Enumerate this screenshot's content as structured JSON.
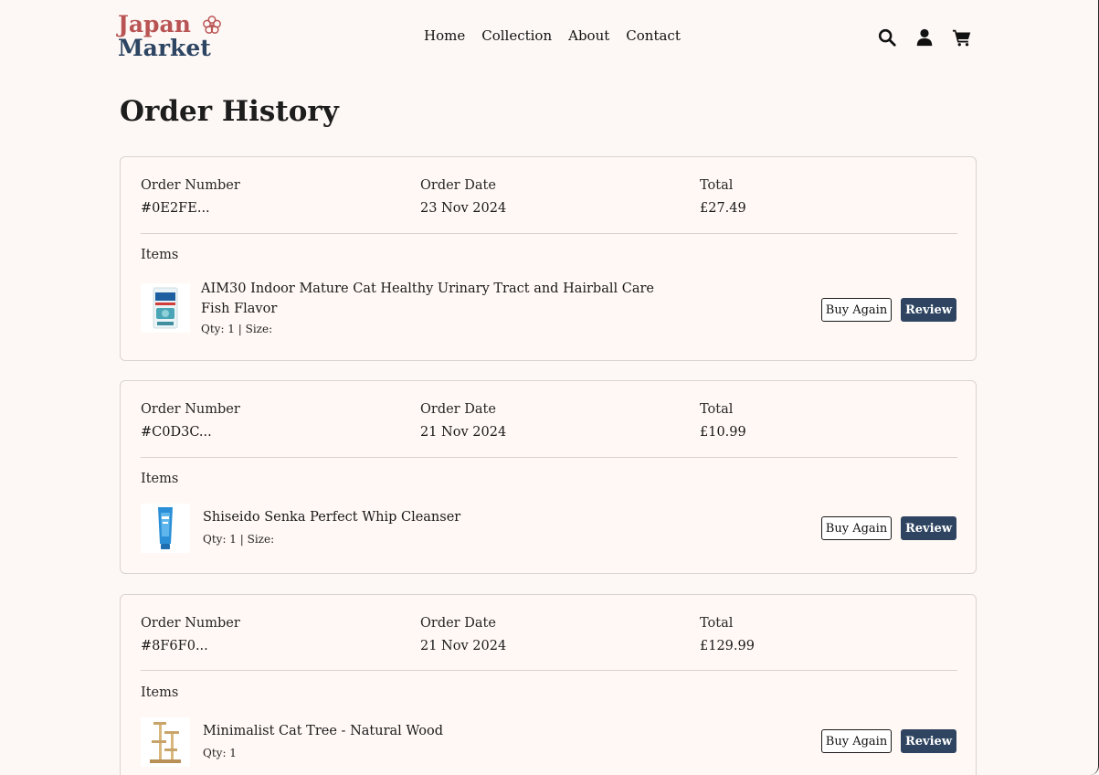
{
  "brand": {
    "line1": "Japan",
    "line2": "Market",
    "color_primary": "#b95454",
    "color_secondary": "#2d4563",
    "flower_icon": "sakura-icon"
  },
  "nav": {
    "items": [
      "Home",
      "Collection",
      "About",
      "Contact"
    ]
  },
  "header_icons": [
    "search-icon",
    "user-icon",
    "cart-icon"
  ],
  "page": {
    "title": "Order History"
  },
  "labels": {
    "order_number": "Order Number",
    "order_date": "Order Date",
    "total": "Total",
    "items": "Items",
    "buy_again": "Buy Again",
    "review": "Review"
  },
  "orders": [
    {
      "number": "#0E2FE...",
      "date": "23 Nov 2024",
      "total": "£27.49",
      "item": {
        "name": "AIM30 Indoor Mature Cat Healthy Urinary Tract and Hairball Care Fish Flavor",
        "details": "Qty: 1 | Size:"
      }
    },
    {
      "number": "#C0D3C...",
      "date": "21 Nov 2024",
      "total": "£10.99",
      "item": {
        "name": "Shiseido Senka Perfect Whip Cleanser",
        "details": "Qty: 1 | Size:"
      }
    },
    {
      "number": "#8F6F0...",
      "date": "21 Nov 2024",
      "total": "£129.99",
      "item": {
        "name": "Minimalist Cat Tree - Natural Wood",
        "details": "Qty: 1"
      }
    }
  ],
  "colors": {
    "background": "#fdf8f5",
    "review_button": "#2e4460",
    "card_border": "#d9d4d0"
  }
}
